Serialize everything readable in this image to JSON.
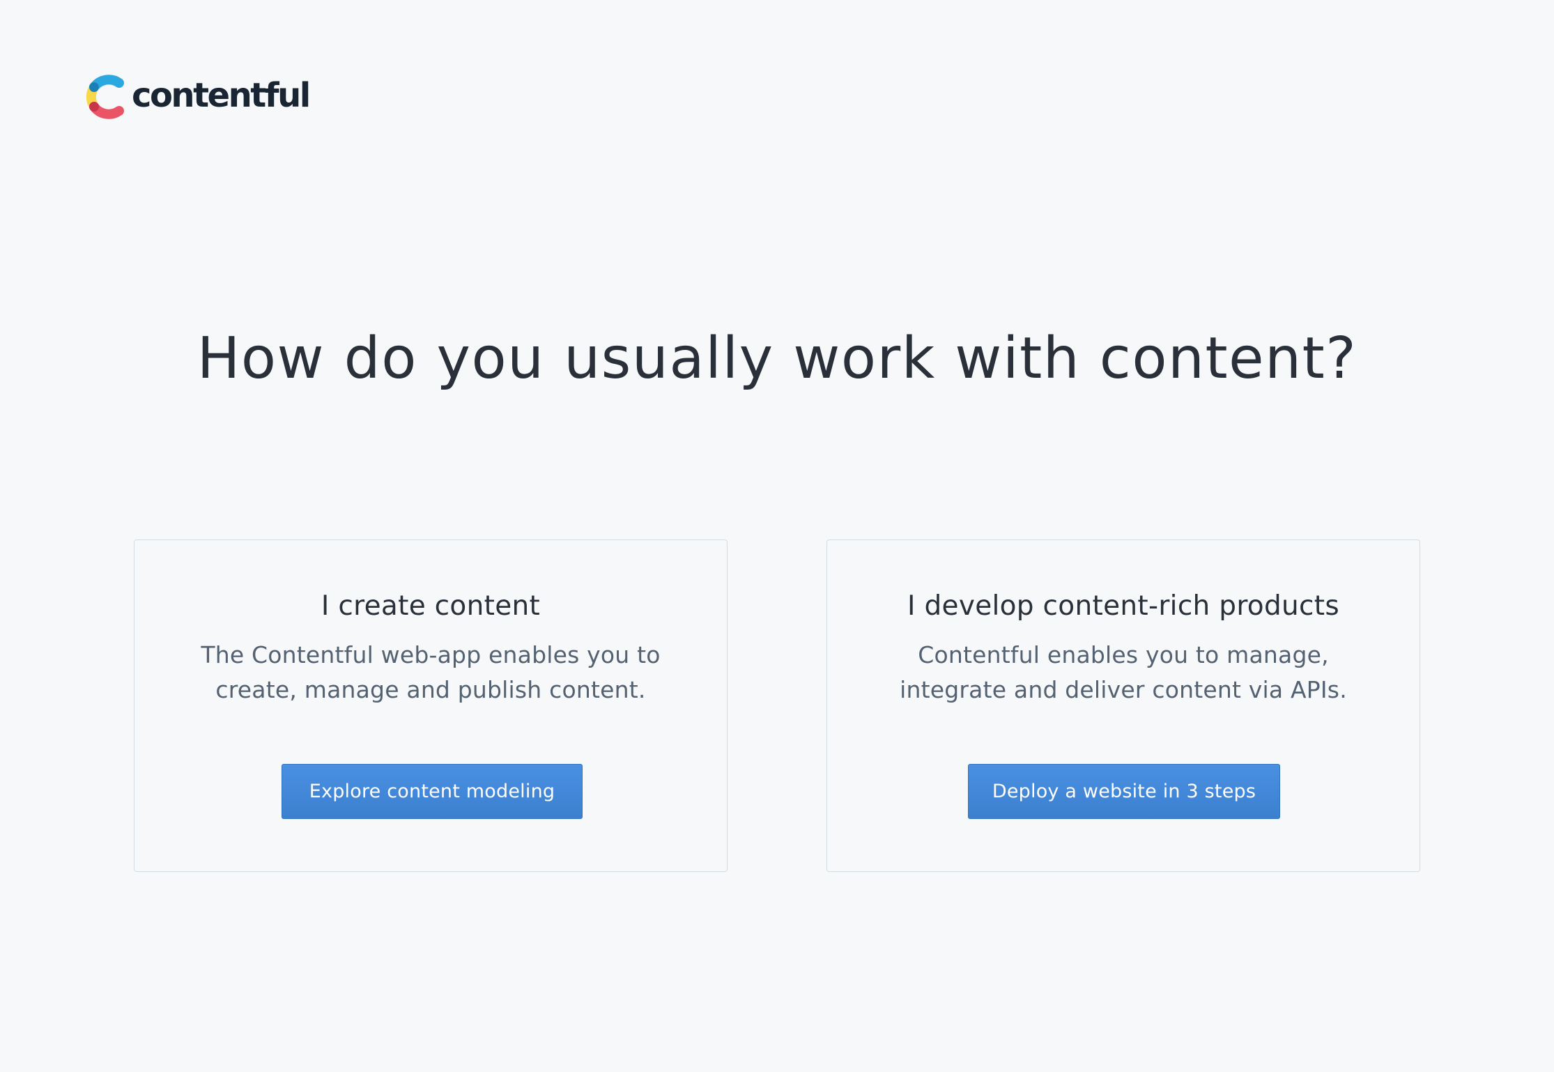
{
  "header": {
    "logo_text": "contentful",
    "colors": {
      "blue": "#2ba8e0",
      "yellow": "#f9d74a",
      "red": "#ea5466"
    }
  },
  "main": {
    "title": "How do you usually work with content?",
    "cards": [
      {
        "title": "I create content",
        "description": "The Contentful web-app enables you to create, manage and publish content.",
        "button_label": "Explore content modeling"
      },
      {
        "title": "I develop content-rich products",
        "description": "Contentful enables you to manage, integrate and deliver content via APIs.",
        "button_label": "Deploy a website in 3 steps"
      }
    ]
  },
  "colors": {
    "background": "#f7f8f9",
    "text_primary": "#2a3039",
    "text_secondary": "#536171",
    "button_primary": "#4a90e2",
    "card_border": "#d3dce0"
  }
}
